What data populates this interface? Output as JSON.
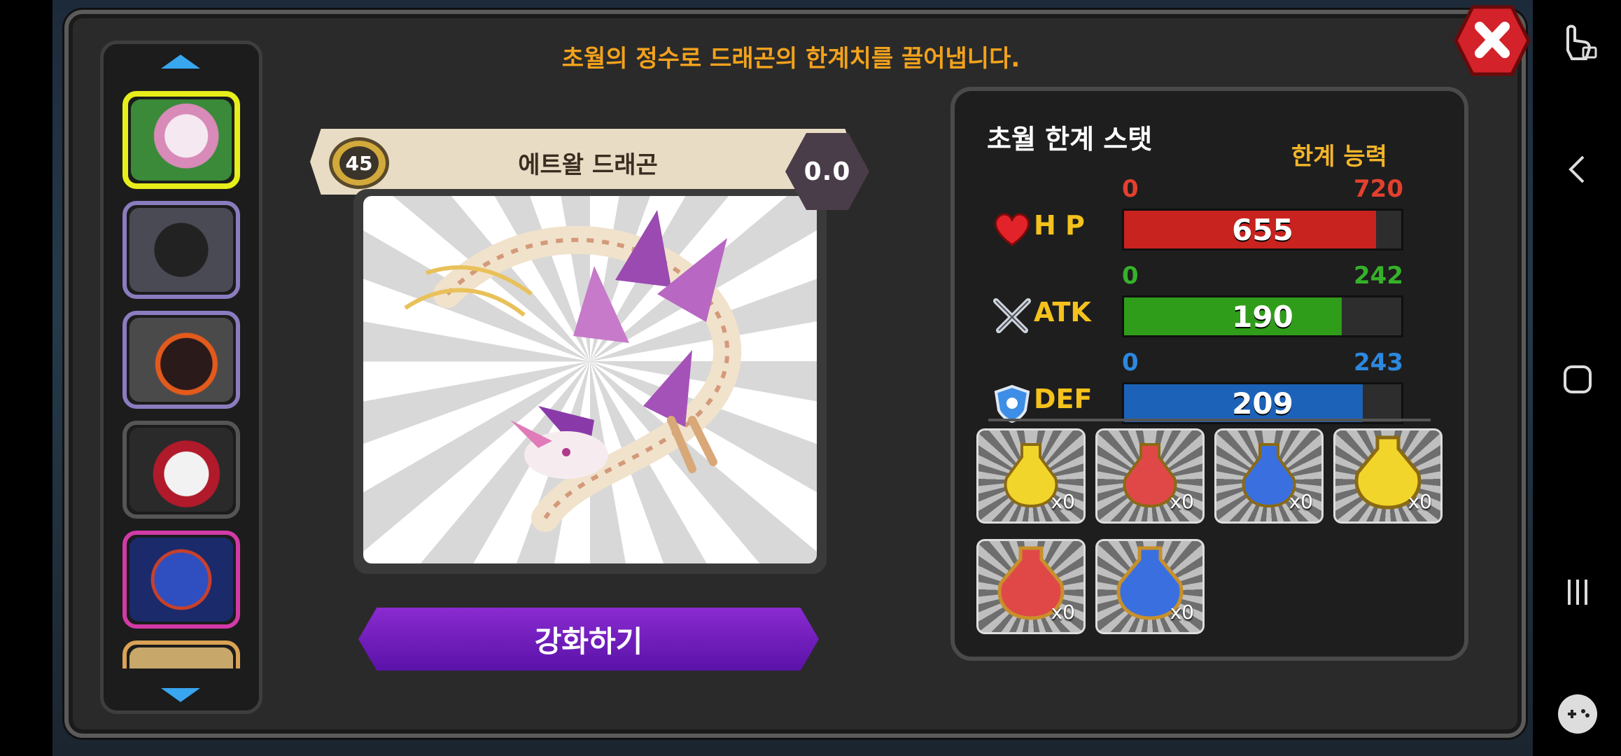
{
  "header": {
    "title": "초월의 정수로 드래곤의 한계치를 끌어냅니다."
  },
  "dragon": {
    "level": "45",
    "name": "에트왈 드래곤",
    "grade": "0.0"
  },
  "actions": {
    "enhance_label": "강화하기"
  },
  "stats": {
    "title": "초월 한계 스탯",
    "subtitle": "한계 능력",
    "rows": [
      {
        "label": "H P",
        "min": "0",
        "max": "720",
        "value": "655",
        "fraction": 0.91,
        "color": "#c8231e",
        "label_color_min": "#e3402f",
        "label_color_max": "#e3402f"
      },
      {
        "label": "ATK",
        "min": "0",
        "max": "242",
        "value": "190",
        "fraction": 0.785,
        "color": "#2f9d1a",
        "label_color_min": "#36b12a",
        "label_color_max": "#36b12a"
      },
      {
        "label": "DEF",
        "min": "0",
        "max": "243",
        "value": "209",
        "fraction": 0.86,
        "color": "#1c62b8",
        "label_color_min": "#2c88e0",
        "label_color_max": "#2c88e0"
      }
    ]
  },
  "items": [
    {
      "count": "x0",
      "color": "#f2d52a",
      "icon": "yellow-potion-icon"
    },
    {
      "count": "x0",
      "color": "#e04848",
      "icon": "red-potion-icon"
    },
    {
      "count": "x0",
      "color": "#3a6fe0",
      "icon": "blue-potion-icon"
    },
    {
      "count": "x0",
      "color": "#f2d52a",
      "icon": "large-yellow-potion-icon"
    },
    {
      "count": "x0",
      "color": "#e04848",
      "icon": "large-red-potion-icon"
    },
    {
      "count": "x0",
      "color": "#3a6fe0",
      "icon": "large-blue-potion-icon"
    }
  ],
  "thumbnails": [
    {
      "icon": "pink-dragon-portrait",
      "bg": "#3a8a3a"
    },
    {
      "icon": "black-dragon-portrait",
      "bg": "#2a2a34"
    },
    {
      "icon": "lava-dragon-portrait",
      "bg": "#3a2a2a"
    },
    {
      "icon": "white-red-dragon-portrait",
      "bg": "#2a2a2a"
    },
    {
      "icon": "blue-dragon-portrait",
      "bg": "#2a3a8a"
    },
    {
      "icon": "tan-dragon-portrait",
      "bg": "#b0905a"
    }
  ],
  "colors": {
    "accent": "#f2a21c",
    "button": "#6a1ebd",
    "selected_border": "#e7ee1a"
  }
}
